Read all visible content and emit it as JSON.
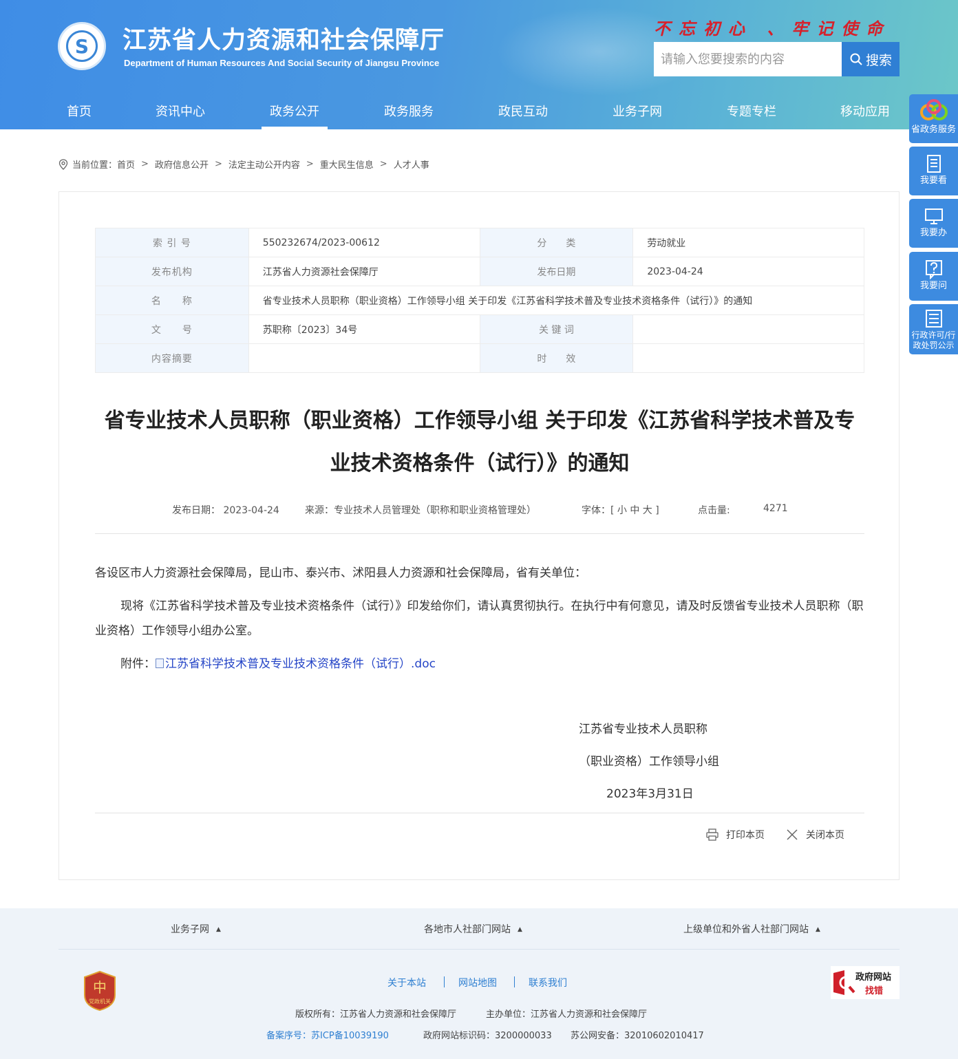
{
  "header": {
    "site_title": "江苏省人力资源和社会保障厅",
    "site_subtitle": "Department of Human Resources And Social Security of Jiangsu Province",
    "slogan": "不忘初心 、牢记使命",
    "search_placeholder": "请输入您要搜索的内容",
    "search_button": "搜索"
  },
  "nav": [
    {
      "label": "首页"
    },
    {
      "label": "资讯中心"
    },
    {
      "label": "政务公开"
    },
    {
      "label": "政务服务"
    },
    {
      "label": "政民互动"
    },
    {
      "label": "业务子网"
    },
    {
      "label": "专题专栏"
    },
    {
      "label": "移动应用"
    }
  ],
  "sidebar": [
    {
      "label": "省政务服务"
    },
    {
      "label": "我要看"
    },
    {
      "label": "我要办"
    },
    {
      "label": "我要问"
    },
    {
      "label": "行政许可/行政处罚公示"
    }
  ],
  "breadcrumb": {
    "prefix": "当前位置：",
    "items": [
      "首页",
      "政府信息公开",
      "法定主动公开内容",
      "重大民生信息",
      "人才人事"
    ],
    "sep": ">"
  },
  "meta": {
    "index_label": "索 引 号",
    "index_value": "550232674/2023-00612",
    "category_label": "分　　类",
    "category_value": "劳动就业",
    "publisher_label": "发布机构",
    "publisher_value": "江苏省人力资源社会保障厅",
    "date_label": "发布日期",
    "date_value": "2023-04-24",
    "name_label": "名　　称",
    "name_value": "省专业技术人员职称（职业资格）工作领导小组 关于印发《江苏省科学技术普及专业技术资格条件（试行）》的通知",
    "docno_label": "文　　号",
    "docno_value": "苏职称〔2023〕34号",
    "keywords_label": "关 键 词",
    "keywords_value": "",
    "summary_label": "内容摘要",
    "summary_value": "",
    "validity_label": "时　　效",
    "validity_value": ""
  },
  "article": {
    "title_line1": "省专业技术人员职称（职业资格）工作领导小组 关于印发《江苏省科学技术普及专",
    "title_line2": "业技术资格条件（试行）》的通知",
    "info_date": "发布日期：  2023-04-24",
    "info_source": "来源：专业技术人员管理处（职称和职业资格管理处）",
    "info_font": "字体：[  小  中  大  ]",
    "info_hits_label": "点击量:",
    "info_hits_value": "4271",
    "para1": "各设区市人力资源社会保障局，昆山市、泰兴市、沭阳县人力资源和社会保障局，省有关单位：",
    "para2": "现将《江苏省科学技术普及专业技术资格条件（试行）》印发给你们，请认真贯彻执行。在执行中有何意见，请及时反馈省专业技术人员职称（职业资格）工作领导小组办公室。",
    "attach_label": "附件：",
    "attach_link": "江苏省科学技术普及专业技术资格条件（试行）.doc",
    "sign_line1": "江苏省专业技术人员职称",
    "sign_line2": "（职业资格）工作领导小组",
    "sign_date": "2023年3月31日",
    "print": "打印本页",
    "close": "关闭本页"
  },
  "footer": {
    "links": [
      "业务子网",
      "各地市人社部门网站",
      "上级单位和外省人社部门网站"
    ],
    "nav": [
      "关于本站",
      "网站地图",
      "联系我们"
    ],
    "copyright": "版权所有：江苏省人力资源和社会保障厅",
    "sponsor": "主办单位：江苏省人力资源和社会保障厅",
    "icp": "备案序号：苏ICP备10039190",
    "site_id": "政府网站标识码：3200000033",
    "police": "苏公网安备：32010602010417",
    "badge_left": "党政机关",
    "badge_right_line1": "政府网站",
    "badge_right_line2": "找错"
  }
}
